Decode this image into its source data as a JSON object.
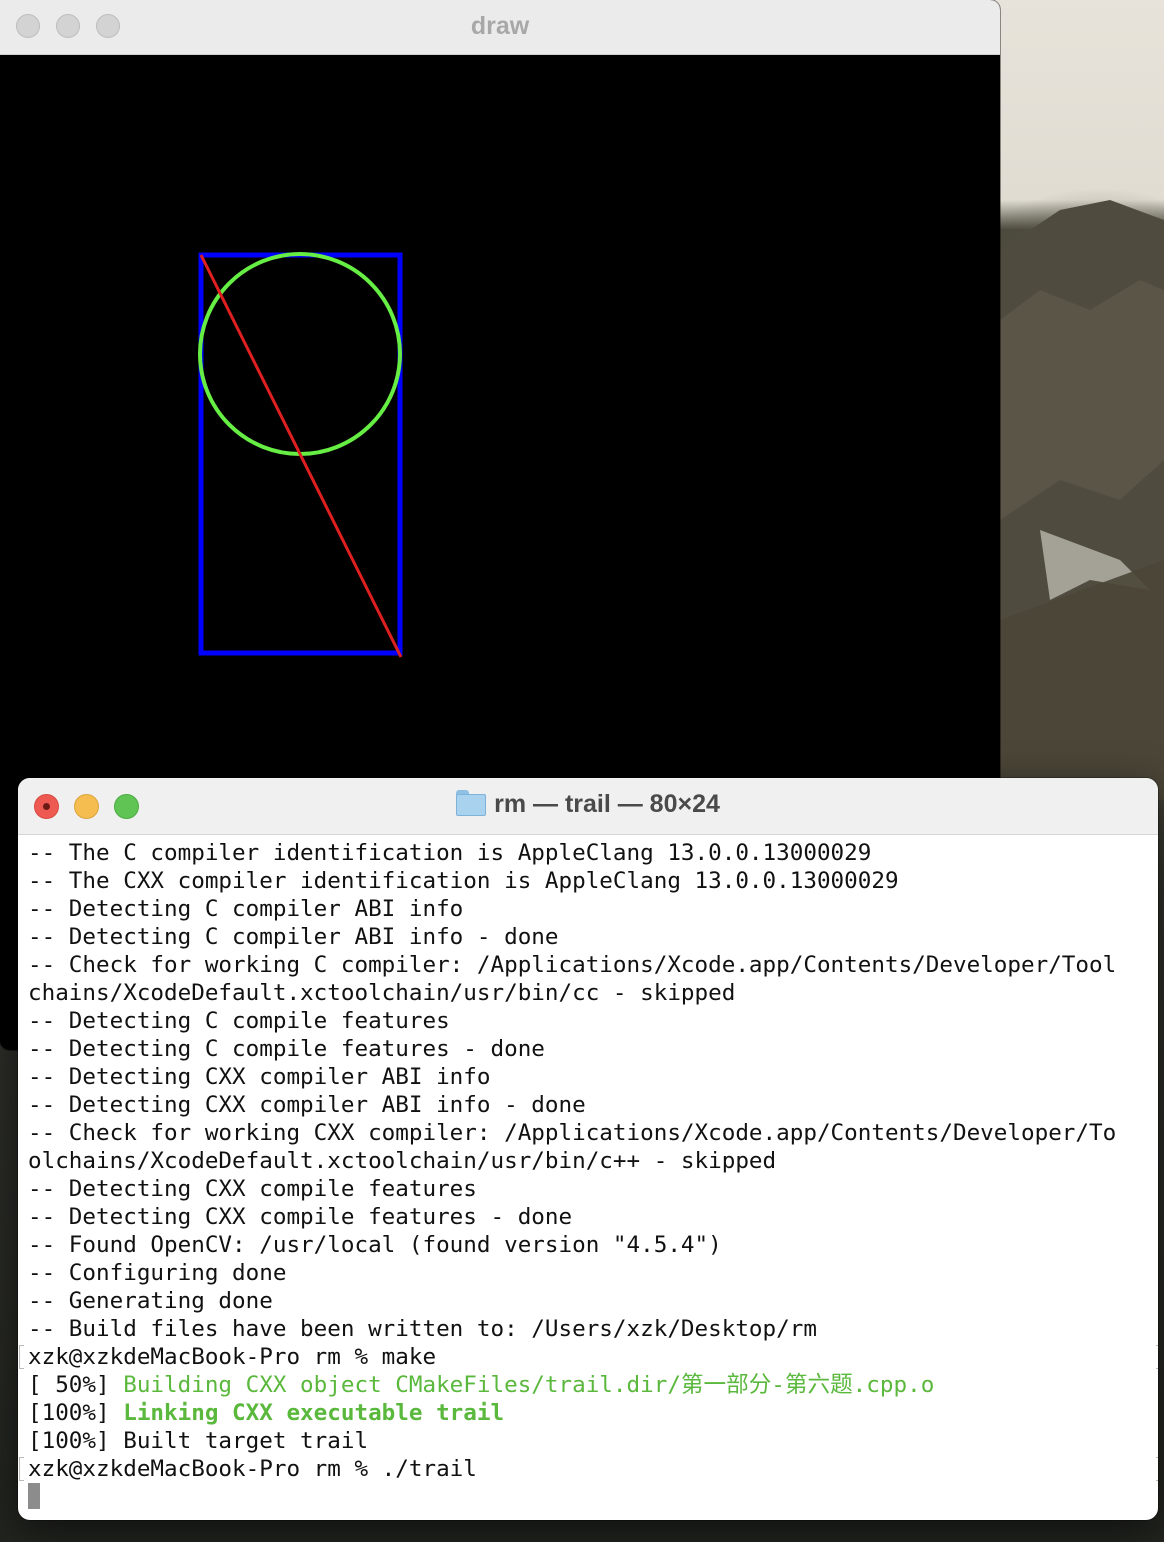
{
  "draw_window": {
    "title": "draw",
    "shapes": {
      "rectangle": {
        "color": "#0000ff"
      },
      "circle": {
        "color": "#66ee44"
      },
      "line": {
        "color": "#e02020"
      }
    }
  },
  "terminal": {
    "title": "rm — trail — 80×24",
    "lines": [
      {
        "segments": [
          {
            "text": "-- The C compiler identification is AppleClang 13.0.0.13000029",
            "style": "normal"
          }
        ]
      },
      {
        "segments": [
          {
            "text": "-- The CXX compiler identification is AppleClang 13.0.0.13000029",
            "style": "normal"
          }
        ]
      },
      {
        "segments": [
          {
            "text": "-- Detecting C compiler ABI info",
            "style": "normal"
          }
        ]
      },
      {
        "segments": [
          {
            "text": "-- Detecting C compiler ABI info - done",
            "style": "normal"
          }
        ]
      },
      {
        "segments": [
          {
            "text": "-- Check for working C compiler: /Applications/Xcode.app/Contents/Developer/Tool",
            "style": "normal"
          }
        ]
      },
      {
        "segments": [
          {
            "text": "chains/XcodeDefault.xctoolchain/usr/bin/cc - skipped",
            "style": "normal"
          }
        ]
      },
      {
        "segments": [
          {
            "text": "-- Detecting C compile features",
            "style": "normal"
          }
        ]
      },
      {
        "segments": [
          {
            "text": "-- Detecting C compile features - done",
            "style": "normal"
          }
        ]
      },
      {
        "segments": [
          {
            "text": "-- Detecting CXX compiler ABI info",
            "style": "normal"
          }
        ]
      },
      {
        "segments": [
          {
            "text": "-- Detecting CXX compiler ABI info - done",
            "style": "normal"
          }
        ]
      },
      {
        "segments": [
          {
            "text": "-- Check for working CXX compiler: /Applications/Xcode.app/Contents/Developer/To",
            "style": "normal"
          }
        ]
      },
      {
        "segments": [
          {
            "text": "olchains/XcodeDefault.xctoolchain/usr/bin/c++ - skipped",
            "style": "normal"
          }
        ]
      },
      {
        "segments": [
          {
            "text": "-- Detecting CXX compile features",
            "style": "normal"
          }
        ]
      },
      {
        "segments": [
          {
            "text": "-- Detecting CXX compile features - done",
            "style": "normal"
          }
        ]
      },
      {
        "segments": [
          {
            "text": "-- Found OpenCV: /usr/local (found version \"4.5.4\")",
            "style": "normal"
          }
        ]
      },
      {
        "segments": [
          {
            "text": "-- Configuring done",
            "style": "normal"
          }
        ]
      },
      {
        "segments": [
          {
            "text": "-- Generating done",
            "style": "normal"
          }
        ]
      },
      {
        "segments": [
          {
            "text": "-- Build files have been written to: /Users/xzk/Desktop/rm",
            "style": "normal"
          }
        ]
      },
      {
        "prompt": true,
        "segments": [
          {
            "text": "xzk@xzkdeMacBook-Pro rm % make",
            "style": "normal"
          }
        ]
      },
      {
        "segments": [
          {
            "text": "[ 50%] ",
            "style": "normal"
          },
          {
            "text": "Building CXX object CMakeFiles/trail.dir/第一部分-第六题.cpp.o",
            "style": "green"
          }
        ]
      },
      {
        "segments": [
          {
            "text": "[100%] ",
            "style": "normal"
          },
          {
            "text": "Linking CXX executable trail",
            "style": "green-bold"
          }
        ]
      },
      {
        "segments": [
          {
            "text": "[100%] Built target trail",
            "style": "normal"
          }
        ]
      },
      {
        "prompt": true,
        "segments": [
          {
            "text": "xzk@xzkdeMacBook-Pro rm % ./trail",
            "style": "normal"
          }
        ]
      }
    ]
  }
}
